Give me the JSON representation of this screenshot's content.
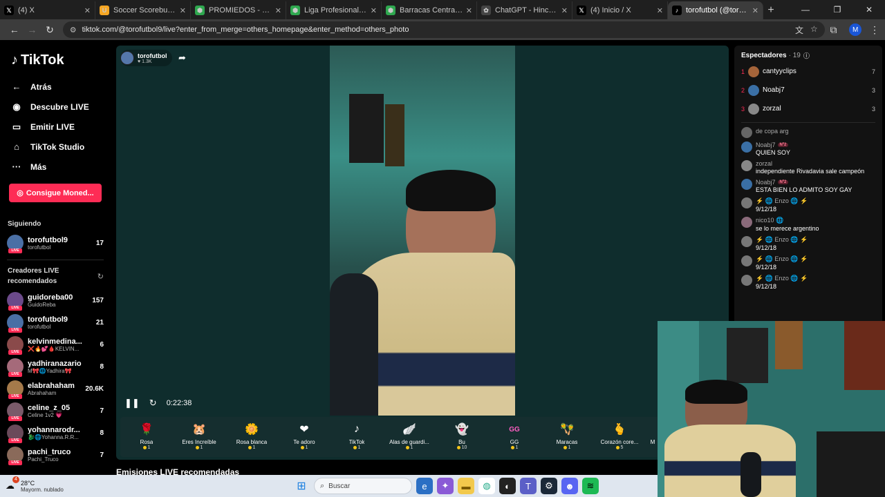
{
  "browser": {
    "tabs": [
      {
        "label": "(4) X",
        "icon": "x-logo-icon",
        "color": "#000000",
        "glyph": "𝕏",
        "active": false
      },
      {
        "label": "Soccer Scorebug - Fresh",
        "icon": "scorebug-icon",
        "color": "#f5a623",
        "glyph": "U",
        "active": false
      },
      {
        "label": "PROMIEDOS - Futbol Arg",
        "icon": "shield-favicon-icon",
        "color": "#2fa84f",
        "glyph": "⬢",
        "active": false
      },
      {
        "label": "Liga Profesional Argentin",
        "icon": "shield-favicon-icon",
        "color": "#2fa84f",
        "glyph": "⬢",
        "active": false
      },
      {
        "label": "Barracas Central Vs Boca",
        "icon": "shield-favicon-icon",
        "color": "#2fa84f",
        "glyph": "⬢",
        "active": false
      },
      {
        "label": "ChatGPT - Hincha enmas",
        "icon": "chatgpt-icon",
        "color": "#444444",
        "glyph": "✿",
        "active": false
      },
      {
        "label": "(4) Inicio / X",
        "icon": "x-logo-icon",
        "color": "#000000",
        "glyph": "𝕏",
        "active": false
      },
      {
        "label": "torofutbol (@torofutb",
        "icon": "tiktok-icon",
        "color": "#000000",
        "glyph": "♪",
        "active": true
      }
    ],
    "url": "tiktok.com/@torofutbol9/live?enter_from_merge=others_homepage&enter_method=others_photo",
    "profile_initial": "M"
  },
  "sidebar": {
    "logo": "TikTok",
    "nav": [
      {
        "label": "Atrás",
        "icon": "back-arrow-icon",
        "glyph": "←"
      },
      {
        "label": "Descubre LIVE",
        "icon": "live-discover-icon",
        "glyph": "◉"
      },
      {
        "label": "Emitir LIVE",
        "icon": "camera-icon",
        "glyph": "▭"
      },
      {
        "label": "TikTok Studio",
        "icon": "studio-house-icon",
        "glyph": "⌂"
      },
      {
        "label": "Más",
        "icon": "more-dots-icon",
        "glyph": "···"
      }
    ],
    "coins_button": "Consigue Moned...",
    "following_title": "Siguiendo",
    "following": [
      {
        "name": "torofutbol9",
        "sub": "torofutbol",
        "count": "17",
        "color": "#4a6fa5"
      }
    ],
    "recommended_title": "Creadores LIVE recomendados",
    "recommended": [
      {
        "name": "guidoreba00",
        "sub": "GuidoReba",
        "count": "157",
        "color": "#6b4a8a"
      },
      {
        "name": "torofutbol9",
        "sub": "torofutbol",
        "count": "21",
        "color": "#4a6fa5"
      },
      {
        "name": "kelvinmedina...",
        "sub": "❌🔥💕🩸KELVIN...",
        "count": "6",
        "color": "#8a4a4a"
      },
      {
        "name": "yadhiranazario",
        "sub": "M🎀🌐Yadhira🎀",
        "count": "8",
        "color": "#a56a7a"
      },
      {
        "name": "elabrahaham",
        "sub": "Abrahaham",
        "count": "20.6K",
        "color": "#a57a4a"
      },
      {
        "name": "celine_z_05",
        "sub": "Celine 1v2 💗",
        "count": "7",
        "color": "#7a5a6a"
      },
      {
        "name": "yohannarodr...",
        "sub": "🐉🌐Yohanna.R.R...",
        "count": "8",
        "color": "#6a4a5a"
      },
      {
        "name": "pachi_truco",
        "sub": "Pachi_Truco",
        "count": "7",
        "color": "#8a6a5a"
      }
    ]
  },
  "player": {
    "streamer": "torofutbol",
    "likes": "♥ 1.3K",
    "time": "0:22:38",
    "gifts": [
      {
        "name": "Rosa",
        "price": "1",
        "glyph": "🌹"
      },
      {
        "name": "Eres Increíble",
        "price": "1",
        "glyph": "🐹"
      },
      {
        "name": "Rosa blanca",
        "price": "1",
        "glyph": "🌼"
      },
      {
        "name": "Te adoro",
        "price": "1",
        "glyph": "❤"
      },
      {
        "name": "TikTok",
        "price": "1",
        "glyph": "♪"
      },
      {
        "name": "Alas de guardi...",
        "price": "1",
        "glyph": "🪽"
      },
      {
        "name": "Bu",
        "price": "10",
        "glyph": "👻"
      },
      {
        "name": "GG",
        "price": "1",
        "glyph": "GG"
      },
      {
        "name": "Maracas",
        "price": "1",
        "glyph": "🪇"
      },
      {
        "name": "Corazón core...",
        "price": "5",
        "glyph": "🫰"
      },
      {
        "name": "M",
        "price": "",
        "glyph": ""
      }
    ],
    "recommended_title": "Emisiones LIVE recomendadas"
  },
  "chat": {
    "viewers_title": "Espectadores",
    "viewers_count": "· 19",
    "top_viewers": [
      {
        "rank": "1",
        "name": "cantyyclips",
        "points": "7",
        "color": "#a5643a"
      },
      {
        "rank": "2",
        "name": "Noabj7",
        "points": "3",
        "color": "#3a6fa5"
      },
      {
        "rank": "3",
        "name": "zorzal",
        "points": "3",
        "color": "#888888"
      }
    ],
    "messages": [
      {
        "user": "",
        "badge": "",
        "text": "de copa arg",
        "color": "#666666"
      },
      {
        "user": "Noabj7",
        "badge": "Nº2",
        "text": "QUIEN SOY",
        "color": "#3a6fa5"
      },
      {
        "user": "zorzal",
        "badge": "",
        "text": "independiente Rivadavia sale campeón",
        "color": "#888888"
      },
      {
        "user": "Noabj7",
        "badge": "Nº2",
        "text": "ESTA BIEN LO ADMITO SOY GAY",
        "color": "#3a6fa5"
      },
      {
        "user": "⚡ 🌐 Enzo 🌐 ⚡",
        "badge": "",
        "text": "9/12/18",
        "color": "#777777"
      },
      {
        "user": "nico10 🌐",
        "badge": "",
        "text": "se lo merece argentino",
        "color": "#8a6a7a"
      },
      {
        "user": "⚡ 🌐 Enzo 🌐 ⚡",
        "badge": "",
        "text": "9/12/18",
        "color": "#777777"
      },
      {
        "user": "⚡ 🌐 Enzo 🌐 ⚡",
        "badge": "",
        "text": "9/12/18",
        "color": "#777777"
      },
      {
        "user": "⚡ 🌐 Enzo 🌐 ⚡",
        "badge": "",
        "text": "9/12/18",
        "color": "#777777"
      }
    ]
  },
  "taskbar": {
    "temp": "28°C",
    "condition": "Mayorm. nublado",
    "notif": "4",
    "search_placeholder": "Buscar"
  }
}
